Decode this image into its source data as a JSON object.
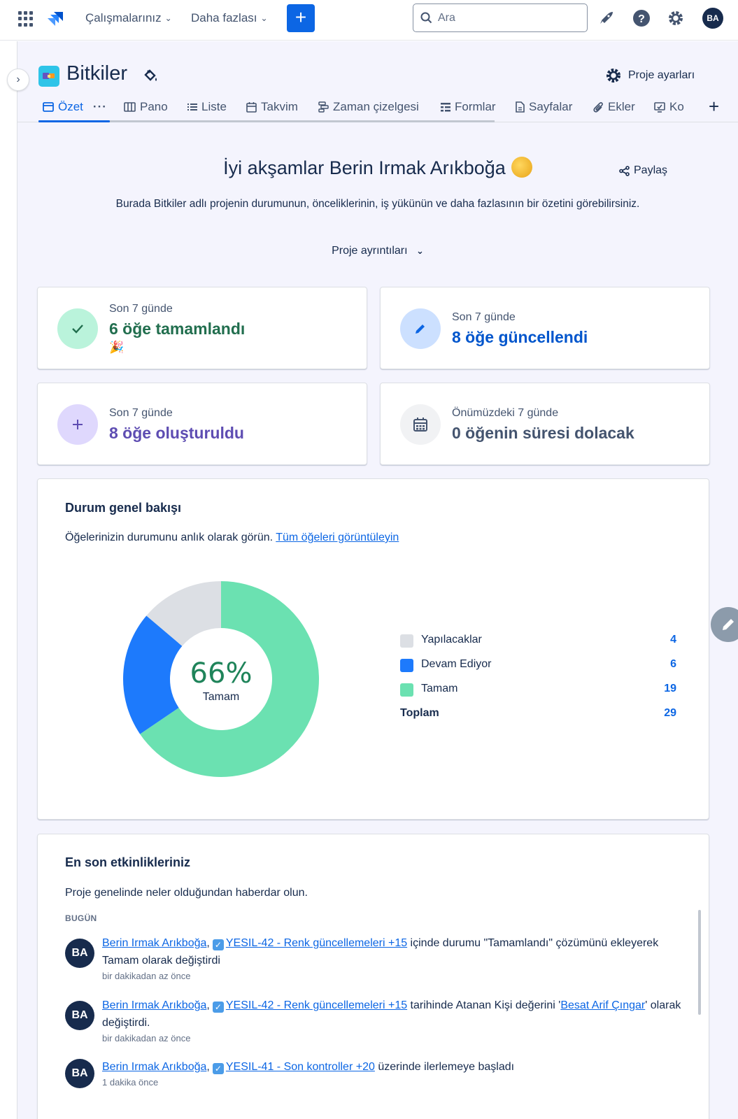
{
  "topnav": {
    "menu_work": "Çalışmalarınız",
    "menu_more": "Daha fazlası",
    "create_label": "+",
    "search_placeholder": "Ara",
    "avatar_initials": "BA"
  },
  "project": {
    "title": "Bitkiler",
    "settings_label": "Proje ayarları"
  },
  "tabs": [
    {
      "label": "Özet",
      "icon": "summary-icon",
      "active": true
    },
    {
      "label": "Pano",
      "icon": "board-icon"
    },
    {
      "label": "Liste",
      "icon": "list-icon"
    },
    {
      "label": "Takvim",
      "icon": "calendar-icon"
    },
    {
      "label": "Zaman çizelgesi",
      "icon": "timeline-icon"
    },
    {
      "label": "Formlar",
      "icon": "forms-icon"
    },
    {
      "label": "Sayfalar",
      "icon": "pages-icon"
    },
    {
      "label": "Ekler",
      "icon": "attachment-icon"
    },
    {
      "label": "Ko",
      "icon": "code-icon"
    }
  ],
  "summary": {
    "greeting": "İyi akşamlar Berin Irmak Arıkboğa",
    "share_label": "Paylaş",
    "intro": "Burada Bitkiler adlı projenin durumunun, önceliklerinin, iş yükünün ve daha fazlasının bir özetini görebilirsiniz.",
    "details_toggle": "Proje ayrıntıları"
  },
  "stats": [
    {
      "period": "Son 7 günde",
      "value": "6 öğe tamamlandı",
      "color": "#216e4e",
      "icon": "check-icon",
      "bg": "#baf3db"
    },
    {
      "period": "Son 7 günde",
      "value": "8 öğe güncellendi",
      "color": "#0055cc",
      "icon": "pencil-icon",
      "bg": "#cce0ff"
    },
    {
      "period": "Son 7 günde",
      "value": "8 öğe oluşturuldu",
      "color": "#5e4db2",
      "icon": "plus-icon",
      "bg": "#dfd8fd"
    },
    {
      "period": "Önümüzdeki 7 günde",
      "value": "0 öğenin süresi dolacak",
      "color": "#44546f",
      "icon": "calendar-icon",
      "bg": "#f1f2f4"
    }
  ],
  "status_overview": {
    "title": "Durum genel bakışı",
    "desc": "Öğelerinizin durumunu anlık olarak görün.",
    "link": "Tüm öğeleri görüntüleyin",
    "center_percent": "66%",
    "center_label": "Tamam",
    "total_label": "Toplam",
    "total_value": "29"
  },
  "chart_data": {
    "type": "pie",
    "categories": [
      "Yapılacaklar",
      "Devam Ediyor",
      "Tamam"
    ],
    "values": [
      4,
      6,
      19
    ],
    "colors": [
      "#dcdfe4",
      "#1d7afc",
      "#6be1b1"
    ],
    "donut": true
  },
  "activity": {
    "title": "En son etkinlikleriniz",
    "desc": "Proje genelinde neler olduğundan haberdar olun.",
    "section_label": "BUGÜN",
    "items": [
      {
        "avatar": "BA",
        "user": "Berin Irmak Arıkboğa",
        "sep": ",",
        "issue": "YESIL-42 - Renk güncellemeleri +15",
        "text": " içinde durumu \"Tamamlandı\" çözümünü ekleyerek Tamam olarak değiştirdi",
        "time": "bir dakikadan az önce"
      },
      {
        "avatar": "BA",
        "user": "Berin Irmak Arıkboğa",
        "sep": ",",
        "issue": "YESIL-42 - Renk güncellemeleri +15",
        "text_a": " tarihinde Atanan Kişi değerini '",
        "assignee": "Besat Arif Çıngar",
        "text_b": "' olarak değiştirdi.",
        "time": "bir dakikadan az önce"
      },
      {
        "avatar": "BA",
        "user": "Berin Irmak Arıkboğa",
        "sep": ",",
        "issue": "YESIL-41 - Son kontroller +20",
        "text": " üzerinde ilerlemeye başladı",
        "time": "1 dakika önce"
      }
    ]
  }
}
